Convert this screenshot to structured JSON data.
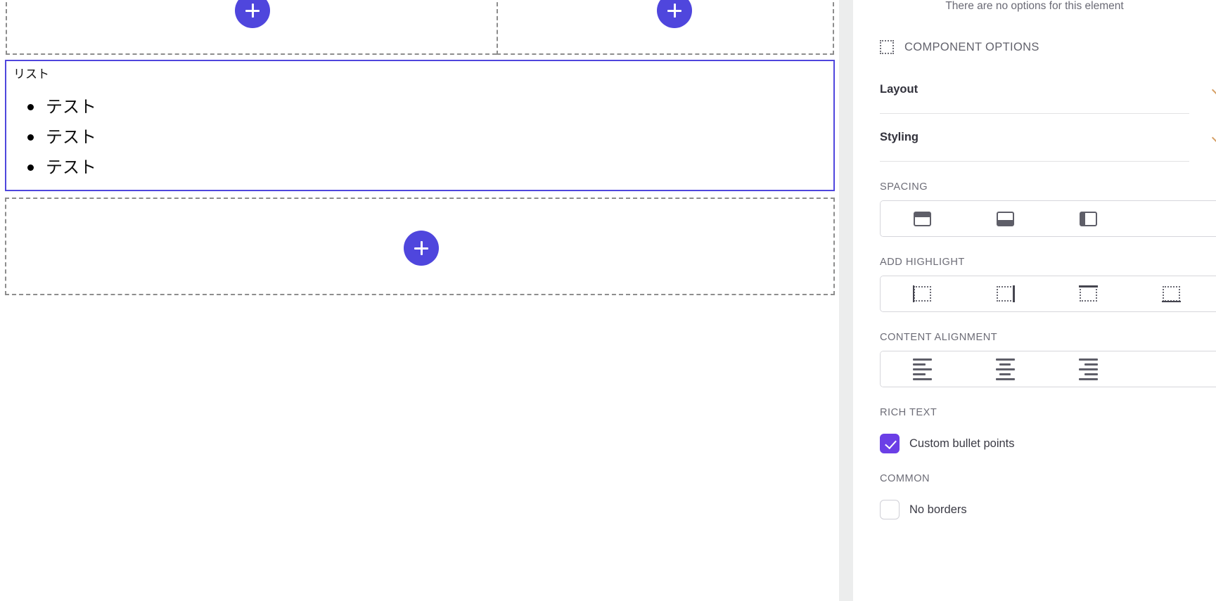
{
  "canvas": {
    "drop_zones": {
      "top_left_add_label": "+",
      "top_right_add_label": "+",
      "lower_add_label": "+"
    },
    "selected_component": {
      "title": "リスト",
      "bullets": [
        "テスト",
        "テスト",
        "テスト"
      ],
      "selection_color": "#4f46dd"
    }
  },
  "panel": {
    "empty_message": "There are no options for this element",
    "section_title": "COMPONENT OPTIONS",
    "accordions": [
      {
        "label": "Layout"
      },
      {
        "label": "Styling"
      }
    ],
    "groups": {
      "spacing": {
        "label": "SPACING",
        "options": [
          {
            "name": "padding-top",
            "icon": "spacing-top-icon"
          },
          {
            "name": "padding-bottom",
            "icon": "spacing-bottom-icon"
          },
          {
            "name": "padding-left",
            "icon": "spacing-left-icon"
          }
        ]
      },
      "add_highlight": {
        "label": "ADD HIGHLIGHT",
        "options": [
          {
            "name": "highlight-left",
            "icon": "highlight-left-icon"
          },
          {
            "name": "highlight-right",
            "icon": "highlight-right-icon"
          },
          {
            "name": "highlight-top",
            "icon": "highlight-top-icon"
          },
          {
            "name": "highlight-bottom",
            "icon": "highlight-bottom-icon"
          }
        ]
      },
      "content_alignment": {
        "label": "CONTENT ALIGNMENT",
        "options": [
          {
            "name": "align-left",
            "icon": "align-left-icon"
          },
          {
            "name": "align-center",
            "icon": "align-center-icon"
          },
          {
            "name": "align-right",
            "icon": "align-right-icon"
          }
        ]
      },
      "rich_text": {
        "label": "RICH TEXT",
        "checkbox_label": "Custom bullet points",
        "checked": true
      },
      "common": {
        "label": "COMMON",
        "checkbox_label": "No borders",
        "checked": false
      }
    },
    "accent_color": "#6b3fe6"
  }
}
